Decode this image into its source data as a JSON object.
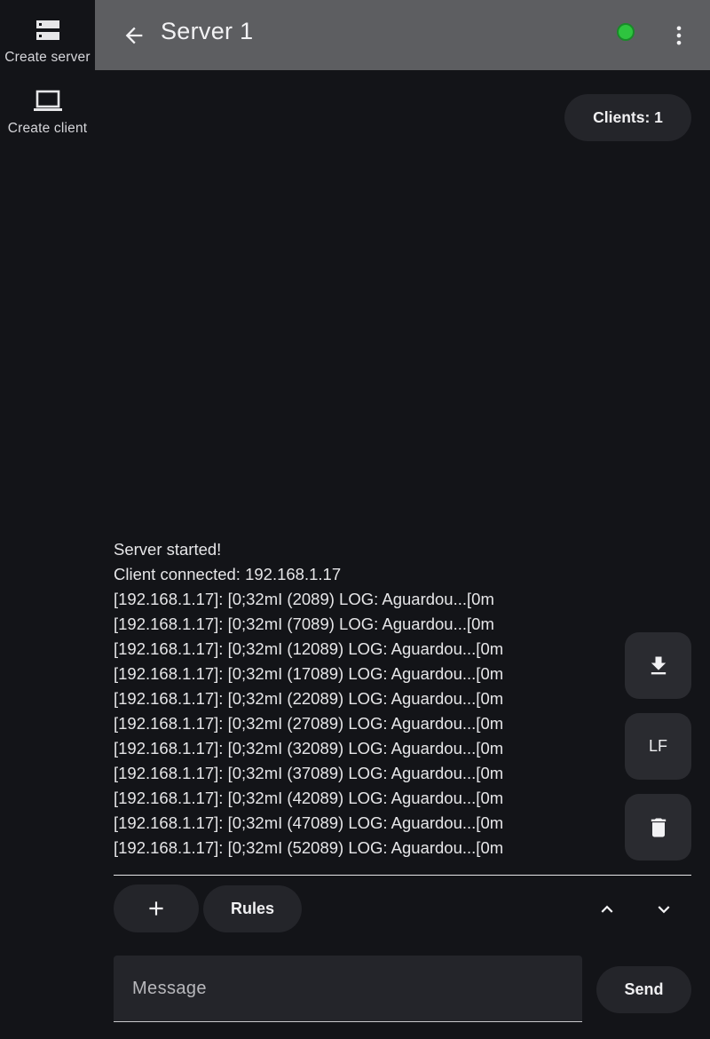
{
  "rail": {
    "items": [
      {
        "label": "Create server",
        "icon": "dns-server-icon"
      },
      {
        "label": "Create client",
        "icon": "laptop-icon"
      }
    ]
  },
  "appbar": {
    "title": "Server 1",
    "back_icon": "arrow-back-icon",
    "status_color": "#2ec43f",
    "more_icon": "more-vert-icon"
  },
  "clients_chip": {
    "label": "Clients: 1"
  },
  "log": {
    "lines": [
      "Server started!",
      "Client connected: 192.168.1.17",
      "[192.168.1.17]: [0;32mI (2089) LOG: Aguardou...[0m",
      "[192.168.1.17]: [0;32mI (7089) LOG: Aguardou...[0m",
      "[192.168.1.17]: [0;32mI (12089) LOG: Aguardou...[0m",
      "[192.168.1.17]: [0;32mI (17089) LOG: Aguardou...[0m",
      "[192.168.1.17]: [0;32mI (22089) LOG: Aguardou...[0m",
      "[192.168.1.17]: [0;32mI (27089) LOG: Aguardou...[0m",
      "[192.168.1.17]: [0;32mI (32089) LOG: Aguardou...[0m",
      "[192.168.1.17]: [0;32mI (37089) LOG: Aguardou...[0m",
      "[192.168.1.17]: [0;32mI (42089) LOG: Aguardou...[0m",
      "[192.168.1.17]: [0;32mI (47089) LOG: Aguardou...[0m",
      "[192.168.1.17]: [0;32mI (52089) LOG: Aguardou...[0m"
    ]
  },
  "side_buttons": {
    "download_icon": "download-icon",
    "lf_label": "LF",
    "delete_icon": "trash-icon"
  },
  "bottom": {
    "add_icon": "plus-icon",
    "rules_label": "Rules",
    "scroll_up_icon": "chevron-up-icon",
    "scroll_down_icon": "chevron-down-icon",
    "message_placeholder": "Message",
    "message_value": "",
    "send_label": "Send"
  }
}
